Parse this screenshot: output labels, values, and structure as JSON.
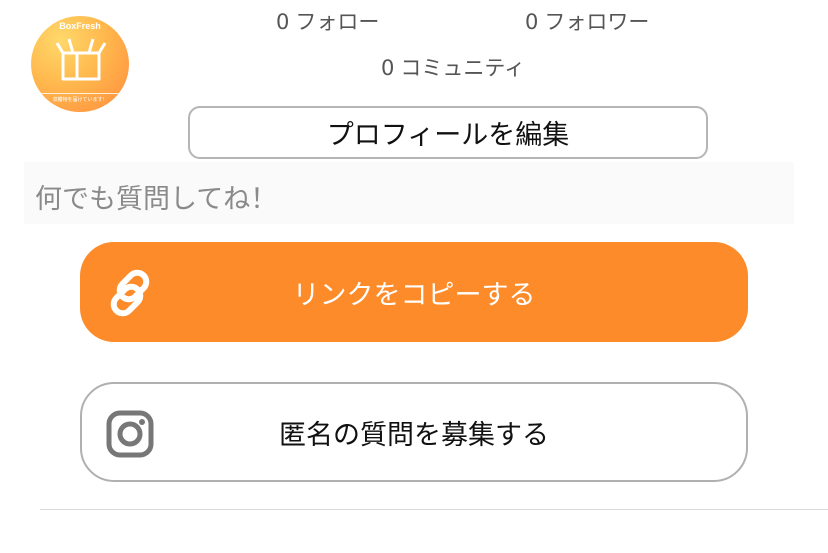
{
  "profile": {
    "avatar_brand": "BoxFresh",
    "avatar_tagline": "収穫物を届けています！",
    "avatar_icon": "box-icon"
  },
  "stats": {
    "follow_count": "0",
    "follow_label": "フォロー",
    "follower_count": "0",
    "follower_label": "フォロワー",
    "community_count": "0",
    "community_label": "コミュニティ"
  },
  "edit_profile_label": "プロフィールを編集",
  "bio_text": "何でも質問してね！",
  "actions": {
    "copy_link_label": "リンクをコピーする",
    "copy_link_icon": "link-icon",
    "copy_link_color": "#fe8b29",
    "anonymous_question_label": "匿名の質問を募集する",
    "anonymous_question_icon": "instagram-icon"
  }
}
